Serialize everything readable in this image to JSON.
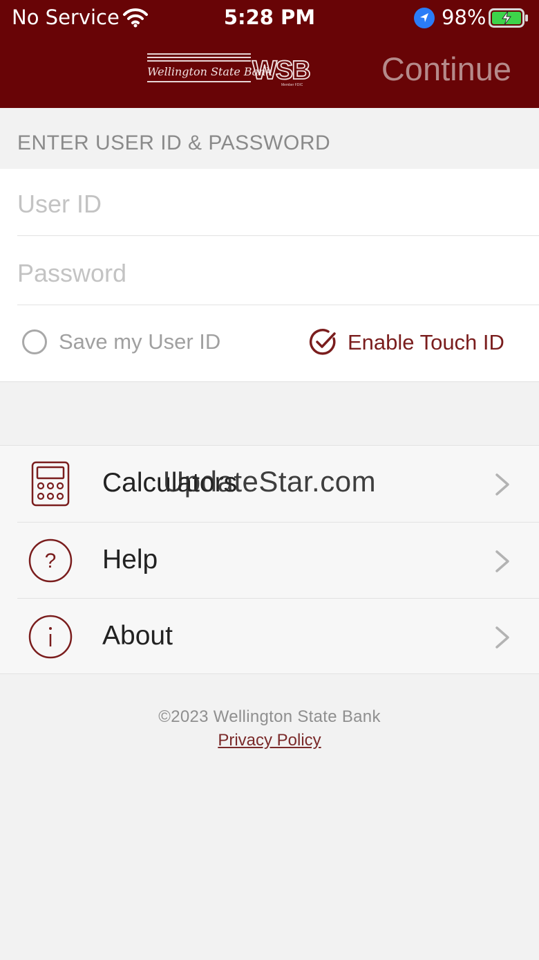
{
  "status_bar": {
    "carrier": "No Service",
    "time": "5:28 PM",
    "battery": "98%"
  },
  "header": {
    "logo_text": "Wellington State Bank",
    "logo_mark": "WSB",
    "logo_sub": "Member FDIC",
    "continue_label": "Continue"
  },
  "login": {
    "section_title": "ENTER USER ID & PASSWORD",
    "user_id_placeholder": "User ID",
    "password_placeholder": "Password",
    "save_user_id_label": "Save my User ID",
    "enable_touch_id_label": "Enable Touch ID",
    "save_user_id_checked": false,
    "enable_touch_id_checked": true
  },
  "menu": {
    "items": [
      {
        "label": "Calculators",
        "icon": "calculator-icon"
      },
      {
        "label": "Help",
        "icon": "question-circle-icon"
      },
      {
        "label": "About",
        "icon": "info-circle-icon"
      }
    ]
  },
  "footer": {
    "copyright": "©2023 Wellington State Bank",
    "privacy_policy": "Privacy Policy"
  },
  "watermark": "UpdateStar.com",
  "colors": {
    "brand": "#680406",
    "accent": "#7a1d1d"
  }
}
